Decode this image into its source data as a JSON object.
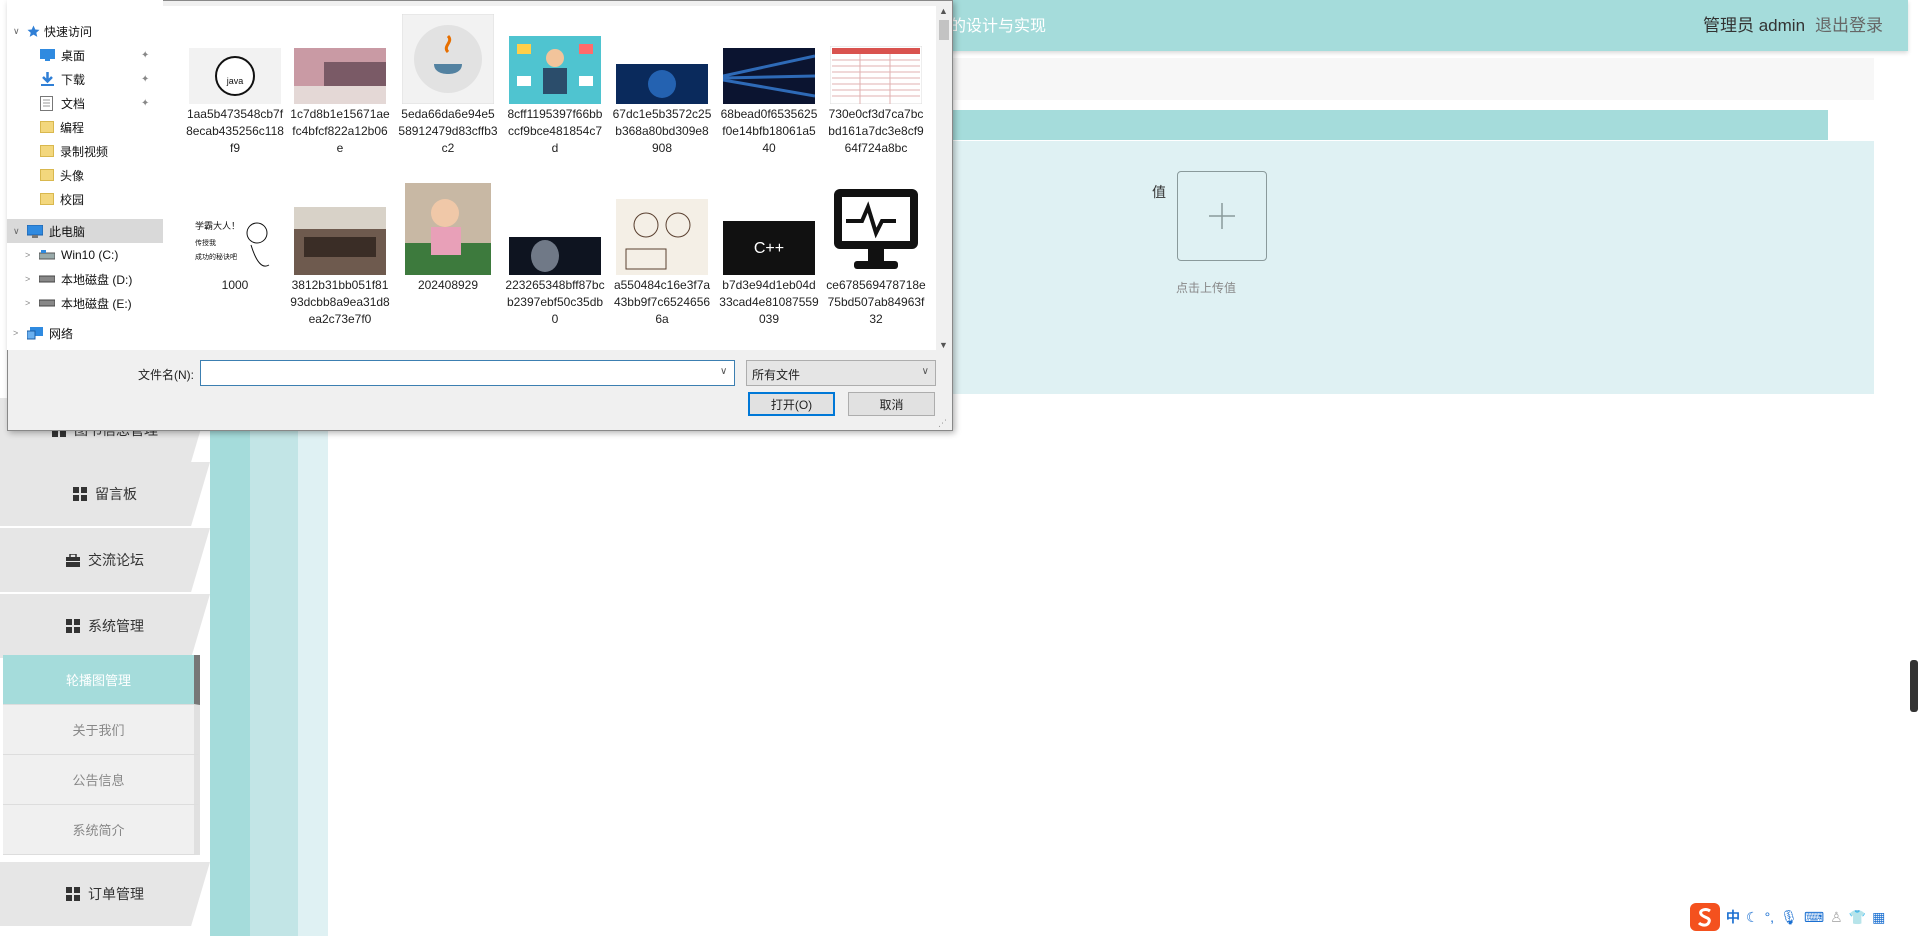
{
  "header": {
    "title": "的设计与实现",
    "user": "管理员 admin",
    "logout": "退出登录"
  },
  "sidebar": {
    "menu": [
      {
        "label": "图书信息管理"
      },
      {
        "label": "留言板"
      },
      {
        "label": "交流论坛"
      },
      {
        "label": "系统管理"
      },
      {
        "label": "订单管理"
      }
    ],
    "submenu": [
      {
        "label": "轮播图管理",
        "active": true
      },
      {
        "label": "关于我们"
      },
      {
        "label": "公告信息"
      },
      {
        "label": "系统简介"
      }
    ]
  },
  "form": {
    "value_label": "值",
    "upload_hint": "点击上传值"
  },
  "dialog": {
    "nav": [
      {
        "label": "快速访问"
      },
      {
        "label": "桌面"
      },
      {
        "label": "下载"
      },
      {
        "label": "文档"
      },
      {
        "label": "编程"
      },
      {
        "label": "录制视频"
      },
      {
        "label": "头像"
      },
      {
        "label": "校园"
      },
      {
        "label": "此电脑"
      },
      {
        "label": "Win10 (C:)"
      },
      {
        "label": "本地磁盘 (D:)"
      },
      {
        "label": "本地磁盘 (E:)"
      },
      {
        "label": "网络"
      }
    ],
    "files": [
      {
        "name": "1aa5b473548cb7f8ecab435256c118f9"
      },
      {
        "name": "1c7d8b1e15671aefc4bfcf822a12b06e"
      },
      {
        "name": "5eda66da6e94e558912479d83cffb3c2"
      },
      {
        "name": "8cff1195397f66bbccf9bce481854c7d"
      },
      {
        "name": "67dc1e5b3572c25b368a80bd309e8908"
      },
      {
        "name": "68bead0f6535625f0e14bfb18061a540"
      },
      {
        "name": "730e0cf3d7ca7bcbd161a7dc3e8cf964f724a8bc"
      },
      {
        "name": "1000"
      },
      {
        "name": "3812b31bb051f8193dcbb8a9ea31d8ea2c73e7f0"
      },
      {
        "name": "202408929"
      },
      {
        "name": "223265348bff87bcb2397ebf50c35db0"
      },
      {
        "name": "a550484c16e3f7a43bb9f7c65246566a"
      },
      {
        "name": "b7d3e94d1eb04d33cad4e81087559039"
      },
      {
        "name": "ce678569478718e75bd507ab84963f32"
      }
    ],
    "thumb_text": {
      "java": "java",
      "xueba_line1": "学霸大人！",
      "xueba_line2": "传授我",
      "xueba_line3": "成功的秘诀吧",
      "cpp": "C++"
    },
    "filename_label": "文件名(N):",
    "filename_value": "",
    "filetype": "所有文件",
    "open_label": "打开(O)",
    "cancel_label": "取消"
  },
  "tray": {
    "ime": "中"
  }
}
